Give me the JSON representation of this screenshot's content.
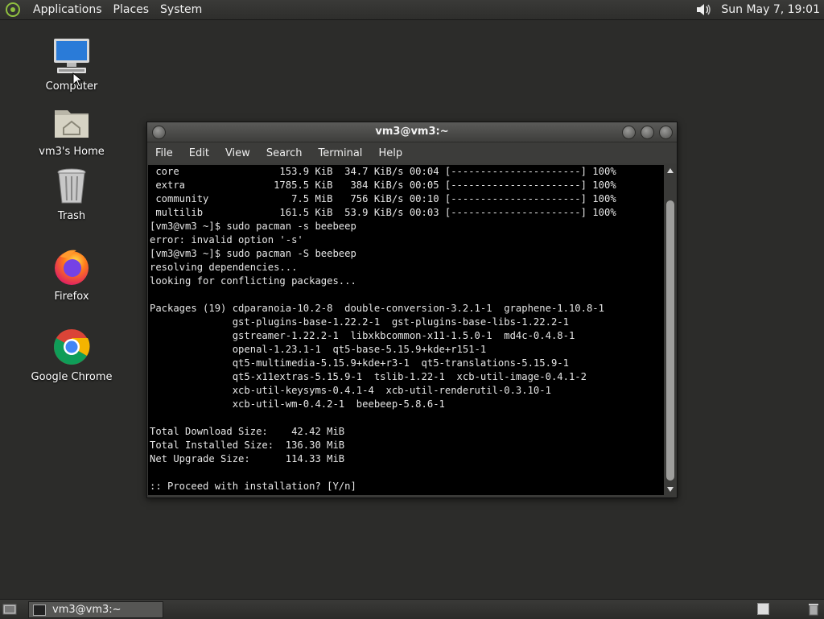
{
  "top_panel": {
    "menus": [
      "Applications",
      "Places",
      "System"
    ],
    "clock": "Sun May  7, 19:01",
    "icons": {
      "logo": "distro-logo-icon",
      "volume": "volume-icon"
    }
  },
  "desktop": {
    "icons": [
      {
        "label": "Computer",
        "icon": "computer-icon"
      },
      {
        "label": "vm3's Home",
        "icon": "home-folder-icon"
      },
      {
        "label": "Trash",
        "icon": "trash-icon"
      },
      {
        "label": "Firefox",
        "icon": "firefox-icon"
      },
      {
        "label": "Google Chrome",
        "icon": "chrome-icon"
      }
    ]
  },
  "window": {
    "title": "vm3@vm3:~",
    "menu": [
      "File",
      "Edit",
      "View",
      "Search",
      "Terminal",
      "Help"
    ],
    "terminal_lines": [
      " core                 153.9 KiB  34.7 KiB/s 00:04 [----------------------] 100%",
      " extra               1785.5 KiB   384 KiB/s 00:05 [----------------------] 100%",
      " community              7.5 MiB   756 KiB/s 00:10 [----------------------] 100%",
      " multilib             161.5 KiB  53.9 KiB/s 00:03 [----------------------] 100%",
      "[vm3@vm3 ~]$ sudo pacman -s beebeep",
      "error: invalid option '-s'",
      "[vm3@vm3 ~]$ sudo pacman -S beebeep",
      "resolving dependencies...",
      "looking for conflicting packages...",
      "",
      "Packages (19) cdparanoia-10.2-8  double-conversion-3.2.1-1  graphene-1.10.8-1",
      "              gst-plugins-base-1.22.2-1  gst-plugins-base-libs-1.22.2-1",
      "              gstreamer-1.22.2-1  libxkbcommon-x11-1.5.0-1  md4c-0.4.8-1",
      "              openal-1.23.1-1  qt5-base-5.15.9+kde+r151-1",
      "              qt5-multimedia-5.15.9+kde+r3-1  qt5-translations-5.15.9-1",
      "              qt5-x11extras-5.15.9-1  tslib-1.22-1  xcb-util-image-0.4.1-2",
      "              xcb-util-keysyms-0.4.1-4  xcb-util-renderutil-0.3.10-1",
      "              xcb-util-wm-0.4.2-1  beebeep-5.8.6-1",
      "",
      "Total Download Size:    42.42 MiB",
      "Total Installed Size:  136.30 MiB",
      "Net Upgrade Size:      114.33 MiB",
      "",
      ":: Proceed with installation? [Y/n]"
    ]
  },
  "taskbar": {
    "tasks": [
      {
        "label": "vm3@vm3:~",
        "icon": "terminal-icon"
      }
    ]
  }
}
